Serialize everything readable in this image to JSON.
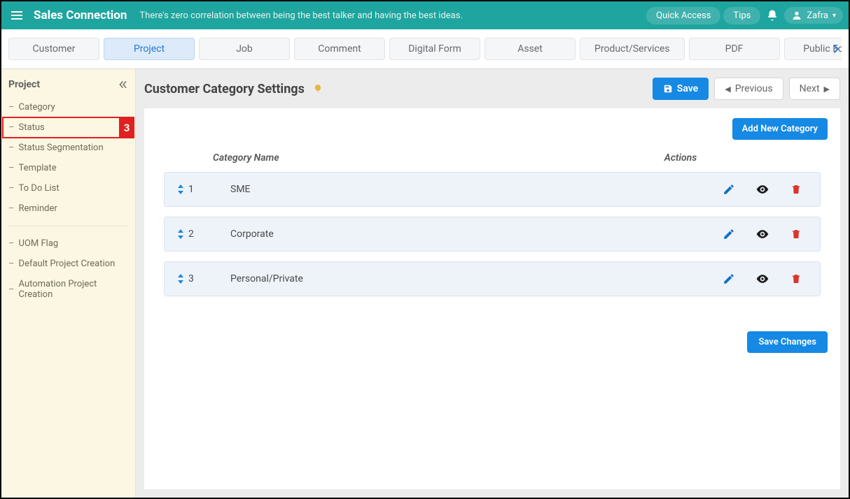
{
  "topbar": {
    "brand": "Sales Connection",
    "tagline": "There's zero correlation between being the best talker and having the best ideas.",
    "quick_access": "Quick Access",
    "tips": "Tips",
    "user": "Zafra"
  },
  "tabs": [
    {
      "label": "Customer",
      "active": false
    },
    {
      "label": "Project",
      "active": true
    },
    {
      "label": "Job",
      "active": false
    },
    {
      "label": "Comment",
      "active": false
    },
    {
      "label": "Digital Form",
      "active": false
    },
    {
      "label": "Asset",
      "active": false
    },
    {
      "label": "Product/Services",
      "active": false
    },
    {
      "label": "PDF",
      "active": false
    },
    {
      "label": "Public Form",
      "active": false
    }
  ],
  "sidebar": {
    "title": "Project",
    "items_top": [
      "Category",
      "Status",
      "Status Segmentation",
      "Template",
      "To Do List",
      "Reminder"
    ],
    "items_bottom": [
      "UOM Flag",
      "Default Project Creation",
      "Automation Project Creation"
    ],
    "highlight_index": 1,
    "highlight_badge": "3"
  },
  "page": {
    "title": "Customer Category Settings",
    "save_label": "Save",
    "prev_label": "Previous",
    "next_label": "Next",
    "add_label": "Add New Category",
    "col_name": "Category Name",
    "col_actions": "Actions",
    "save_changes": "Save Changes"
  },
  "categories": [
    {
      "n": "1",
      "name": "SME"
    },
    {
      "n": "2",
      "name": "Corporate"
    },
    {
      "n": "3",
      "name": "Personal/Private"
    }
  ]
}
